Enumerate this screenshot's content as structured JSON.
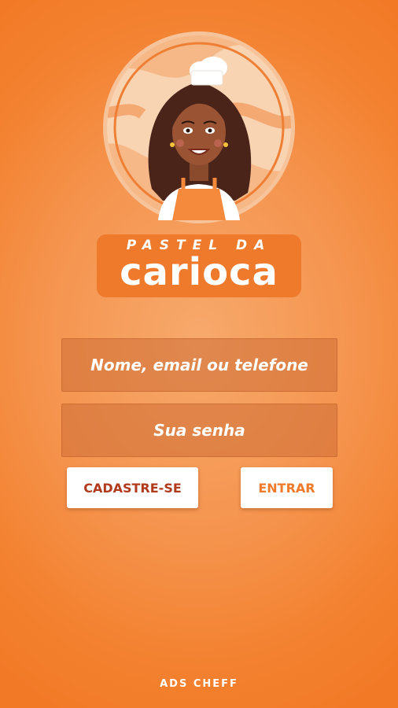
{
  "brand": {
    "top_label": "PASTEL DA",
    "main_label": "carioca",
    "hat_text": "carioca"
  },
  "form": {
    "user_placeholder": "Nome, email ou telefone",
    "password_placeholder": "Sua senha"
  },
  "actions": {
    "signup_label": "CADASTRE-SE",
    "login_label": "ENTRAR"
  },
  "footer": {
    "credit": "ADS CHEFF"
  },
  "colors": {
    "background": "#f3812f",
    "brand_orange": "#f07a2a",
    "signup_text": "#b03a1b",
    "button_bg": "#ffffff"
  },
  "icons": {
    "logo": "chef-woman-mascot-icon"
  }
}
